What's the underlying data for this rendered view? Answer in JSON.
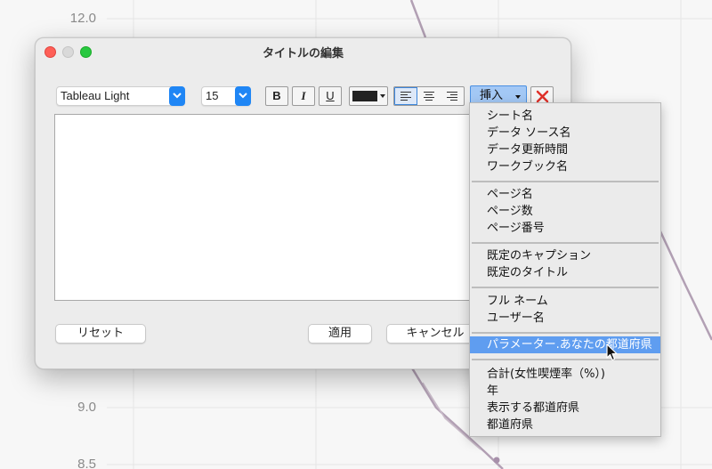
{
  "background": {
    "y_ticks": [
      "12.0",
      "9.0",
      "8.5"
    ],
    "line_color": "#b2a0b4"
  },
  "dialog": {
    "title": "タイトルの編集",
    "font_family_value": "Tableau Light",
    "font_size_value": "15",
    "bold_label": "B",
    "italic_label": "I",
    "underline_label": "U",
    "text_color": "#222222",
    "insert_label": "挿入",
    "reset_label": "リセット",
    "apply_label": "適用",
    "cancel_label": "キャンセル"
  },
  "menu": {
    "groups": [
      [
        "シート名",
        "データ ソース名",
        "データ更新時間",
        "ワークブック名"
      ],
      [
        "ページ名",
        "ページ数",
        "ページ番号"
      ],
      [
        "既定のキャプション",
        "既定のタイトル"
      ],
      [
        "フル ネーム",
        "ユーザー名"
      ],
      [
        "パラメーター.あなたの都道府県"
      ],
      [
        "合計(女性喫煙率（%）)",
        "年",
        "表示する都道府県",
        "都道府県"
      ]
    ],
    "highlighted": "パラメーター.あなたの都道府県",
    "highlight_color": "#5f9df0"
  }
}
